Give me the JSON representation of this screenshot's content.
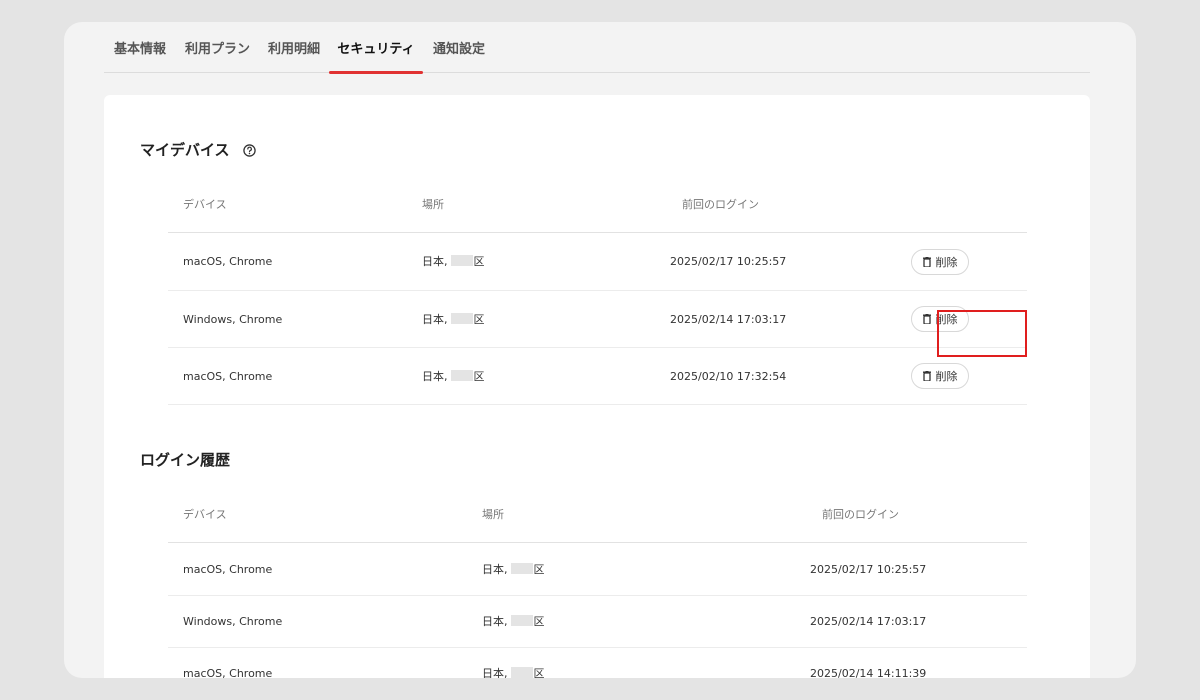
{
  "tabs": [
    {
      "label": "基本情報"
    },
    {
      "label": "利用プラン"
    },
    {
      "label": "利用明細"
    },
    {
      "label": "セキュリティ"
    },
    {
      "label": "通知設定"
    }
  ],
  "active_tab": "セキュリティ",
  "accent_color": "#e03131",
  "my_devices": {
    "title": "マイデバイス",
    "headers": {
      "device": "デバイス",
      "location": "場所",
      "last_login": "前回のログイン"
    },
    "delete_label": "削除",
    "rows": [
      {
        "device": "macOS, Chrome",
        "location_prefix": "日本,",
        "location_suffix": "区",
        "last_login": "2025/02/17 10:25:57"
      },
      {
        "device": "Windows, Chrome",
        "location_prefix": "日本,",
        "location_suffix": "区",
        "last_login": "2025/02/14 17:03:17"
      },
      {
        "device": "macOS, Chrome",
        "location_prefix": "日本,",
        "location_suffix": "区",
        "last_login": "2025/02/10 17:32:54"
      }
    ]
  },
  "login_history": {
    "title": "ログイン履歴",
    "headers": {
      "device": "デバイス",
      "location": "場所",
      "last_login": "前回のログイン"
    },
    "rows": [
      {
        "device": "macOS, Chrome",
        "location_prefix": "日本,",
        "location_suffix": "区",
        "last_login": "2025/02/17 10:25:57"
      },
      {
        "device": "Windows, Chrome",
        "location_prefix": "日本,",
        "location_suffix": "区",
        "last_login": "2025/02/14 17:03:17"
      },
      {
        "device": "macOS, Chrome",
        "location_prefix": "日本,",
        "location_suffix": "区",
        "last_login": "2025/02/14 14:11:39"
      }
    ]
  }
}
